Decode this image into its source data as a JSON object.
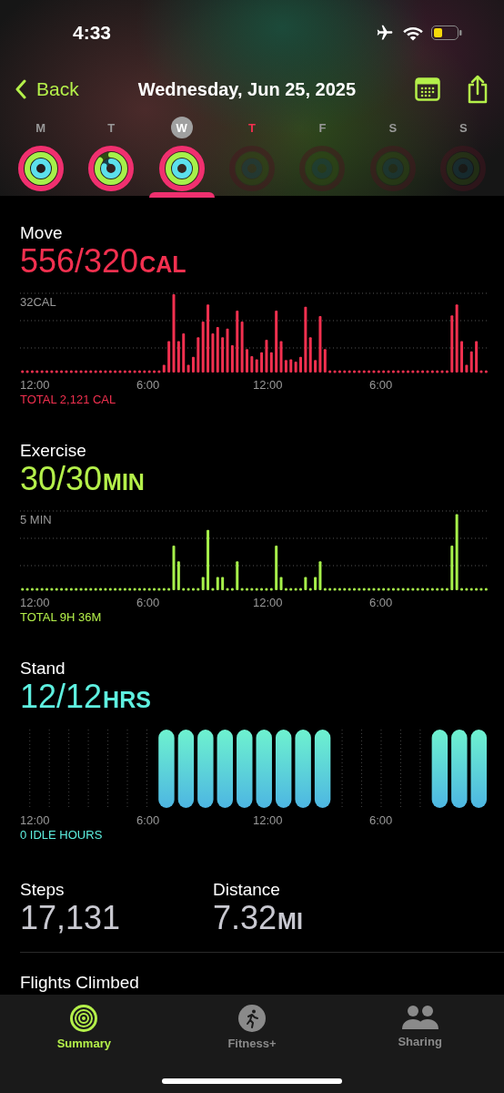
{
  "status_bar": {
    "time": "4:33"
  },
  "nav": {
    "back": "Back",
    "title": "Wednesday, Jun 25, 2025"
  },
  "days": [
    {
      "letter": "M",
      "selected": false,
      "today": false,
      "kind": "closed"
    },
    {
      "letter": "T",
      "selected": false,
      "today": false,
      "kind": "partial"
    },
    {
      "letter": "W",
      "selected": true,
      "today": false,
      "kind": "closed"
    },
    {
      "letter": "T",
      "selected": false,
      "today": true,
      "kind": "future"
    },
    {
      "letter": "F",
      "selected": false,
      "today": false,
      "kind": "future"
    },
    {
      "letter": "S",
      "selected": false,
      "today": false,
      "kind": "future"
    },
    {
      "letter": "S",
      "selected": false,
      "today": false,
      "kind": "future"
    }
  ],
  "metrics": [
    {
      "kind": "move",
      "label": "Move",
      "value": "556/320",
      "unit": "CAL",
      "scale_label": "32CAL",
      "x_labels": [
        "12:00",
        "6:00",
        "12:00",
        "6:00"
      ],
      "total": "TOTAL 2,121 CAL"
    },
    {
      "kind": "exercise",
      "label": "Exercise",
      "value": "30/30",
      "unit": "MIN",
      "scale_label": "5 MIN",
      "x_labels": [
        "12:00",
        "6:00",
        "12:00",
        "6:00"
      ],
      "total": "TOTAL 9H 36M"
    },
    {
      "kind": "stand",
      "label": "Stand",
      "value": "12/12",
      "unit": "HRS",
      "x_labels": [
        "12:00",
        "6:00",
        "12:00",
        "6:00"
      ],
      "total": "0 IDLE HOURS"
    }
  ],
  "stats": [
    {
      "label": "Steps",
      "value": "17,131"
    },
    {
      "label": "Distance",
      "value": "7.32",
      "unit": "MI"
    }
  ],
  "flights": {
    "label": "Flights Climbed"
  },
  "tabs": [
    {
      "label": "Summary",
      "selected": true
    },
    {
      "label": "Fitness+",
      "selected": false
    },
    {
      "label": "Sharing",
      "selected": false
    }
  ]
}
